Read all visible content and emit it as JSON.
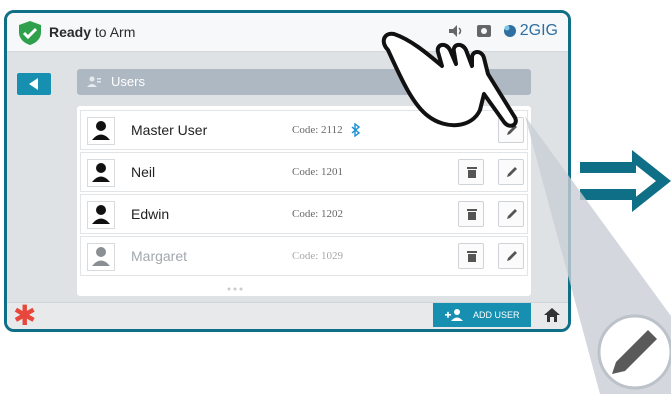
{
  "status": {
    "prefix": "Ready",
    "suffix": "to Arm",
    "brand": "2GIG"
  },
  "header": {
    "title": "Users"
  },
  "users": [
    {
      "name": "Master User",
      "code": "Code: 2112",
      "bluetooth": true,
      "deletable": false
    },
    {
      "name": "Neil",
      "code": "Code: 1201",
      "bluetooth": false,
      "deletable": true
    },
    {
      "name": "Edwin",
      "code": "Code: 1202",
      "bluetooth": false,
      "deletable": true
    },
    {
      "name": "Margaret",
      "code": "Code: 1029",
      "bluetooth": false,
      "deletable": true
    }
  ],
  "footer": {
    "add_user_label": "ADD USER"
  },
  "colors": {
    "accent": "#168fb0",
    "border": "#0f6f86",
    "shield": "#2fa04c",
    "alert": "#e8483b",
    "arrow": "#0f6f86"
  },
  "icons": [
    "shield-check-icon",
    "speaker-icon",
    "camera-icon",
    "brand-logo-icon",
    "back-arrow-icon",
    "users-icon",
    "person-icon",
    "bluetooth-icon",
    "trash-icon",
    "pencil-icon",
    "asterisk-icon",
    "add-user-icon",
    "home-icon",
    "pointing-hand-icon",
    "double-arrow-icon"
  ]
}
